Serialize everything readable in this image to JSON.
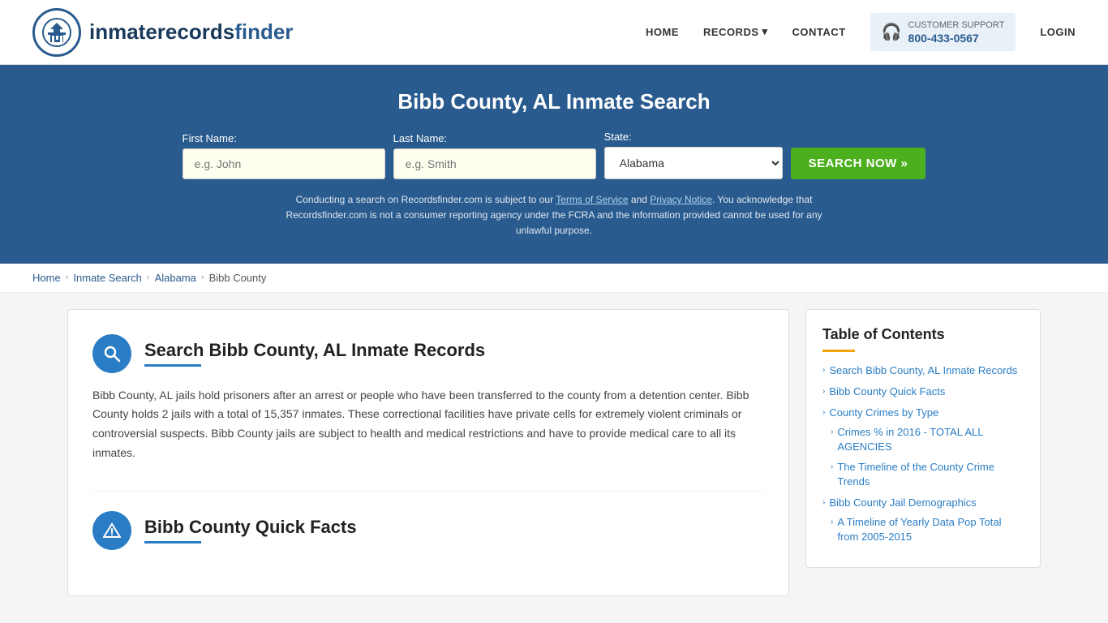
{
  "header": {
    "logo_text_normal": "inmaterecords",
    "logo_text_bold": "finder",
    "nav": {
      "home_label": "HOME",
      "records_label": "RECORDS",
      "contact_label": "CONTACT",
      "support_label": "CUSTOMER SUPPORT",
      "support_number": "800-433-0567",
      "login_label": "LOGIN"
    }
  },
  "hero": {
    "title": "Bibb County, AL Inmate Search",
    "first_name_label": "First Name:",
    "first_name_placeholder": "e.g. John",
    "last_name_label": "Last Name:",
    "last_name_placeholder": "e.g. Smith",
    "state_label": "State:",
    "state_value": "Alabama",
    "search_button": "SEARCH NOW »",
    "disclaimer": "Conducting a search on Recordsfinder.com is subject to our Terms of Service and Privacy Notice. You acknowledge that Recordsfinder.com is not a consumer reporting agency under the FCRA and the information provided cannot be used for any unlawful purpose."
  },
  "breadcrumb": {
    "items": [
      "Home",
      "Inmate Search",
      "Alabama",
      "Bibb County"
    ]
  },
  "content": {
    "section1": {
      "title": "Search Bibb County, AL Inmate Records",
      "icon": "🔍",
      "body": "Bibb County, AL jails hold prisoners after an arrest or people who have been transferred to the county from a detention center. Bibb County holds 2 jails with a total of 15,357 inmates. These correctional facilities have private cells for extremely violent criminals or controversial suspects. Bibb County jails are subject to health and medical restrictions and have to provide medical care to all its inmates."
    },
    "section2": {
      "title": "Bibb County Quick Facts",
      "icon": "⚠"
    }
  },
  "toc": {
    "title": "Table of Contents",
    "items": [
      {
        "label": "Search Bibb County, AL Inmate Records",
        "sub": false
      },
      {
        "label": "Bibb County Quick Facts",
        "sub": false
      },
      {
        "label": "County Crimes by Type",
        "sub": false
      },
      {
        "label": "Crimes % in 2016 - TOTAL ALL AGENCIES",
        "sub": true
      },
      {
        "label": "The Timeline of the County Crime Trends",
        "sub": true
      },
      {
        "label": "Bibb County Jail Demographics",
        "sub": false
      },
      {
        "label": "A Timeline of Yearly Data Pop Total from 2005-2015",
        "sub": true
      }
    ]
  }
}
